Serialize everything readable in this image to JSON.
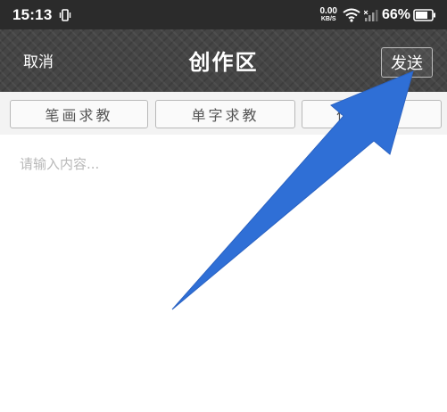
{
  "status_bar": {
    "time": "15:13",
    "net_speed_value": "0.00",
    "net_speed_unit": "KB/S",
    "battery_percent": "66%",
    "icons": [
      "vibrate-icon",
      "wifi-icon",
      "signal-icon",
      "battery-icon"
    ]
  },
  "header": {
    "cancel_label": "取消",
    "title": "创作区",
    "send_label": "发送"
  },
  "tabs": [
    {
      "label": "笔画求教"
    },
    {
      "label": "单字求教"
    },
    {
      "label": "作"
    }
  ],
  "editor": {
    "placeholder": "请输入内容..."
  },
  "colors": {
    "status_bar_bg": "#2b2b2b",
    "title_bar_bg": "#454545",
    "tabs_bg": "#f3f3f3",
    "annotation_arrow": "#2f6fd6"
  }
}
